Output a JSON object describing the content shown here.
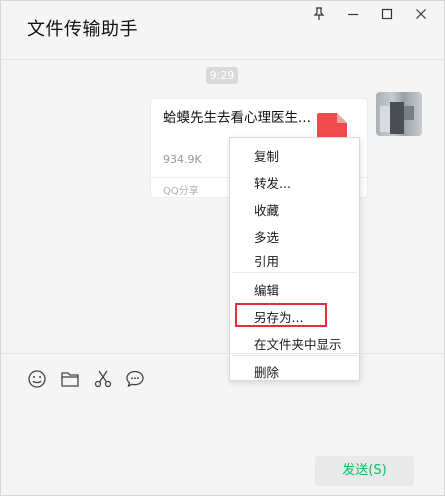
{
  "chat": {
    "title": "文件传输助手"
  },
  "window_controls": [
    "pin-icon",
    "minimize-icon",
    "maximize-icon",
    "close-icon"
  ],
  "message": {
    "time": "9:29",
    "file": {
      "name": "蛤蟆先生去看心理医生...",
      "size": "934.9K",
      "source": "QQ分享",
      "icon": "pdf-file-icon",
      "icon_color": "#f04a4a"
    }
  },
  "context_menu": {
    "items": [
      "复制",
      "转发...",
      "收藏",
      "多选",
      "引用",
      "编辑",
      "另存为...",
      "在文件夹中显示",
      "删除"
    ],
    "highlighted": "另存为...",
    "highlight_color": "#e0303a"
  },
  "toolbar": [
    "emoji-icon",
    "folder-icon",
    "scissors-icon",
    "chat-bubble-icon"
  ],
  "composer": {
    "send_label": "发送(S)",
    "send_color": "#07c160"
  }
}
